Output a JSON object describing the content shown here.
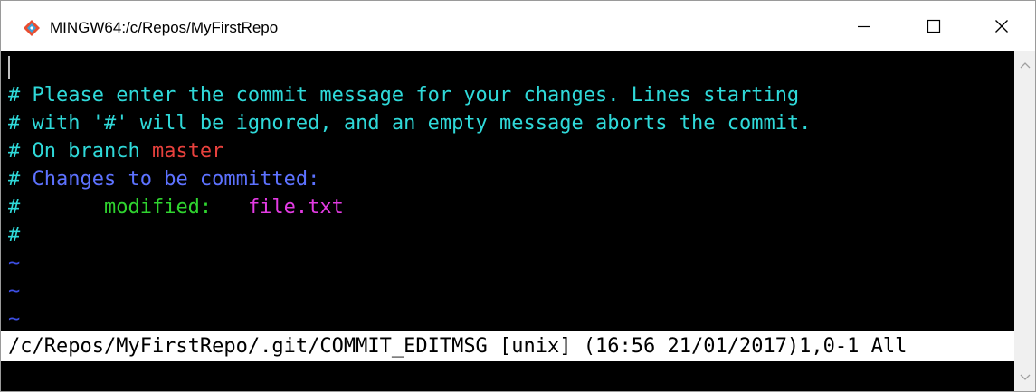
{
  "window": {
    "title": "MINGW64:/c/Repos/MyFirstRepo",
    "icon": "git-bash-icon",
    "controls": [
      "minimize-icon",
      "maximize-icon",
      "close-icon"
    ]
  },
  "terminal": {
    "lines": [
      {
        "segments": [
          {
            "text": "# Please enter the commit message for your changes. Lines starting",
            "color": "#2fd9d9"
          }
        ]
      },
      {
        "segments": [
          {
            "text": "# with '#' will be ignored, and an empty message aborts the commit.",
            "color": "#2fd9d9"
          }
        ]
      },
      {
        "segments": [
          {
            "text": "# On branch ",
            "color": "#2fd9d9"
          },
          {
            "text": "master",
            "color": "#e8413d"
          }
        ]
      },
      {
        "segments": [
          {
            "text": "# ",
            "color": "#2fd9d9"
          },
          {
            "text": "Changes to be committed:",
            "color": "#5d72ff"
          }
        ]
      },
      {
        "segments": [
          {
            "text": "#       ",
            "color": "#2fd9d9"
          },
          {
            "text": "modified:",
            "color": "#2fd42f"
          },
          {
            "text": "   ",
            "color": "#2fd42f"
          },
          {
            "text": "file.txt",
            "color": "#e33be3"
          }
        ]
      },
      {
        "segments": [
          {
            "text": "#",
            "color": "#2fd9d9"
          }
        ]
      },
      {
        "segments": [
          {
            "text": "~",
            "color": "#3d4fe6"
          }
        ]
      },
      {
        "segments": [
          {
            "text": "~",
            "color": "#3d4fe6"
          }
        ]
      },
      {
        "segments": [
          {
            "text": "~",
            "color": "#3d4fe6"
          }
        ]
      }
    ],
    "status_line": "/c/Repos/MyFirstRepo/.git/COMMIT_EDITMSG [unix] (16:56 21/01/2017)1,0-1 All"
  },
  "colors": {
    "background": "#000000",
    "comment": "#2fd9d9",
    "branch": "#e8413d",
    "section": "#5d72ff",
    "modified": "#2fd42f",
    "filename": "#e33be3",
    "tilde": "#3d4fe6"
  }
}
